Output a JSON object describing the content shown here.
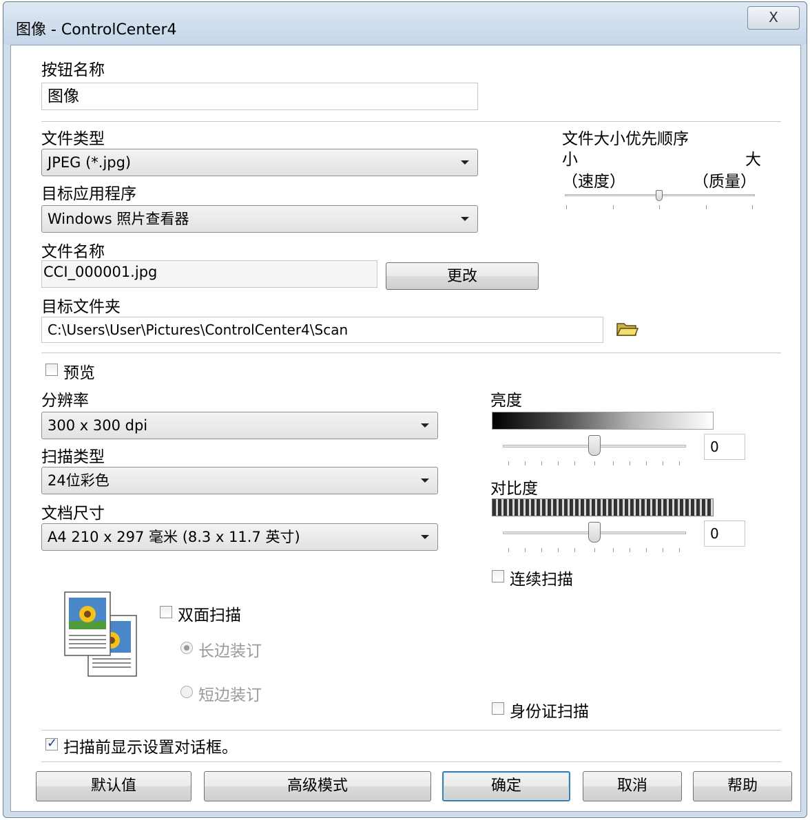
{
  "window": {
    "title": "图像 - ControlCenter4",
    "close_label": "X"
  },
  "button_name": {
    "label": "按钮名称",
    "value": "图像"
  },
  "file_type": {
    "label": "文件类型",
    "value": "JPEG (*.jpg)"
  },
  "file_size_priority": {
    "label": "文件大小优先顺序",
    "min_label": "小",
    "min_sub": "（速度）",
    "max_label": "大",
    "max_sub": "（质量）",
    "level": 0.5
  },
  "target_app": {
    "label": "目标应用程序",
    "value": "Windows 照片查看器"
  },
  "file_name": {
    "label": "文件名称",
    "value": "CCI_000001.jpg",
    "change_button": "更改"
  },
  "target_folder": {
    "label": "目标文件夹",
    "value": "C:\\Users\\User\\Pictures\\ControlCenter4\\Scan",
    "icon": "folder-icon"
  },
  "preview": {
    "label": "预览",
    "checked": false
  },
  "resolution": {
    "label": "分辨率",
    "value": "300 x 300 dpi"
  },
  "scan_type": {
    "label": "扫描类型",
    "value": "24位彩色"
  },
  "doc_size": {
    "label": "文档尺寸",
    "value": "A4 210 x 297 毫米 (8.3 x 11.7 英寸)"
  },
  "brightness": {
    "label": "亮度",
    "value": "0"
  },
  "contrast": {
    "label": "对比度",
    "value": "0"
  },
  "continuous_scan": {
    "label": "连续扫描",
    "checked": false
  },
  "duplex": {
    "label": "双面扫描",
    "checked": false,
    "long_edge": "长边装订",
    "short_edge": "短边装订",
    "selected": "长边装订"
  },
  "id_card_scan": {
    "label": "身份证扫描",
    "checked": false
  },
  "show_settings": {
    "label": "扫描前显示设置对话框。",
    "checked": true
  },
  "buttons": {
    "default": "默认值",
    "advanced": "高级模式",
    "ok": "确定",
    "cancel": "取消",
    "help": "帮助"
  }
}
